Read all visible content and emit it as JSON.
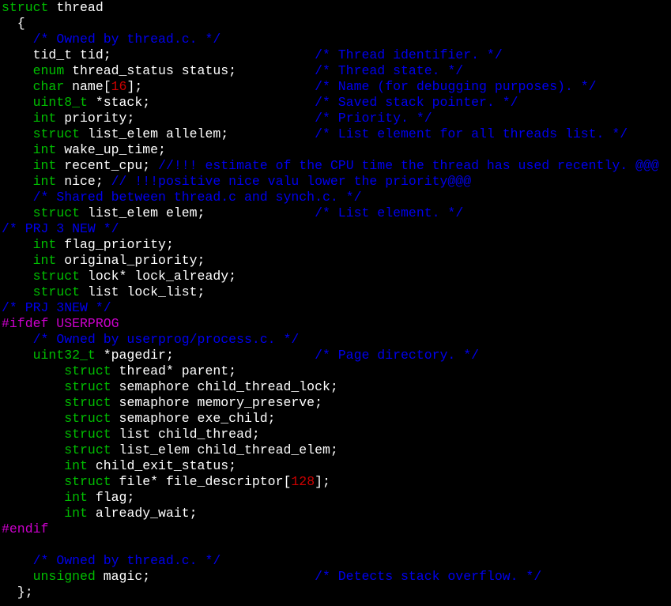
{
  "colors": {
    "background": "#000000",
    "keyword": "#00bd00",
    "identifier": "#ffffff",
    "preprocessor": "#cd00cd",
    "number": "#cd0000",
    "comment": "#0000ee"
  },
  "lines": [
    [
      [
        "kw",
        "struct"
      ],
      [
        "id",
        " thread"
      ]
    ],
    [
      [
        "id",
        "  {"
      ]
    ],
    [
      [
        "id",
        "    "
      ],
      [
        "cm",
        "/* Owned by thread.c. */"
      ]
    ],
    [
      [
        "id",
        "    tid_t tid;                          "
      ],
      [
        "cm",
        "/* Thread identifier. */"
      ]
    ],
    [
      [
        "id",
        "    "
      ],
      [
        "kw",
        "enum"
      ],
      [
        "id",
        " thread_status status;          "
      ],
      [
        "cm",
        "/* Thread state. */"
      ]
    ],
    [
      [
        "id",
        "    "
      ],
      [
        "kw",
        "char"
      ],
      [
        "id",
        " name["
      ],
      [
        "num",
        "16"
      ],
      [
        "id",
        "];                      "
      ],
      [
        "cm",
        "/* Name (for debugging purposes). */"
      ]
    ],
    [
      [
        "id",
        "    "
      ],
      [
        "kw",
        "uint8_t"
      ],
      [
        "id",
        " *stack;                     "
      ],
      [
        "cm",
        "/* Saved stack pointer. */"
      ]
    ],
    [
      [
        "id",
        "    "
      ],
      [
        "kw",
        "int"
      ],
      [
        "id",
        " priority;                       "
      ],
      [
        "cm",
        "/* Priority. */"
      ]
    ],
    [
      [
        "id",
        "    "
      ],
      [
        "kw",
        "struct"
      ],
      [
        "id",
        " list_elem allelem;           "
      ],
      [
        "cm",
        "/* List element for all threads list. */"
      ]
    ],
    [
      [
        "id",
        "    "
      ],
      [
        "kw",
        "int"
      ],
      [
        "id",
        " wake_up_time;"
      ]
    ],
    [
      [
        "id",
        "    "
      ],
      [
        "kw",
        "int"
      ],
      [
        "id",
        " recent_cpu; "
      ],
      [
        "cm",
        "//!!! estimate of the CPU time the thread has used recently. @@@"
      ]
    ],
    [
      [
        "id",
        "    "
      ],
      [
        "kw",
        "int"
      ],
      [
        "id",
        " nice; "
      ],
      [
        "cm",
        "// !!!positive nice valu lower the priority@@@"
      ]
    ],
    [
      [
        "id",
        "    "
      ],
      [
        "cm",
        "/* Shared between thread.c and synch.c. */"
      ]
    ],
    [
      [
        "id",
        "    "
      ],
      [
        "kw",
        "struct"
      ],
      [
        "id",
        " list_elem elem;              "
      ],
      [
        "cm",
        "/* List element. */"
      ]
    ],
    [
      [
        "cm",
        "/* PRJ 3 NEW */"
      ]
    ],
    [
      [
        "id",
        "    "
      ],
      [
        "kw",
        "int"
      ],
      [
        "id",
        " flag_priority;"
      ]
    ],
    [
      [
        "id",
        "    "
      ],
      [
        "kw",
        "int"
      ],
      [
        "id",
        " original_priority;"
      ]
    ],
    [
      [
        "id",
        "    "
      ],
      [
        "kw",
        "struct"
      ],
      [
        "id",
        " lock* lock_already;"
      ]
    ],
    [
      [
        "id",
        "    "
      ],
      [
        "kw",
        "struct"
      ],
      [
        "id",
        " list lock_list;"
      ]
    ],
    [
      [
        "cm",
        "/* PRJ 3NEW */"
      ]
    ],
    [
      [
        "pp",
        "#ifdef USERPROG"
      ]
    ],
    [
      [
        "id",
        "    "
      ],
      [
        "cm",
        "/* Owned by userprog/process.c. */"
      ]
    ],
    [
      [
        "id",
        "    "
      ],
      [
        "kw",
        "uint32_t"
      ],
      [
        "id",
        " *pagedir;                  "
      ],
      [
        "cm",
        "/* Page directory. */"
      ]
    ],
    [
      [
        "id",
        "        "
      ],
      [
        "kw",
        "struct"
      ],
      [
        "id",
        " thread* parent;"
      ]
    ],
    [
      [
        "id",
        "        "
      ],
      [
        "kw",
        "struct"
      ],
      [
        "id",
        " semaphore child_thread_lock;"
      ]
    ],
    [
      [
        "id",
        "        "
      ],
      [
        "kw",
        "struct"
      ],
      [
        "id",
        " semaphore memory_preserve;"
      ]
    ],
    [
      [
        "id",
        "        "
      ],
      [
        "kw",
        "struct"
      ],
      [
        "id",
        " semaphore exe_child;"
      ]
    ],
    [
      [
        "id",
        "        "
      ],
      [
        "kw",
        "struct"
      ],
      [
        "id",
        " list child_thread;"
      ]
    ],
    [
      [
        "id",
        "        "
      ],
      [
        "kw",
        "struct"
      ],
      [
        "id",
        " list_elem child_thread_elem;"
      ]
    ],
    [
      [
        "id",
        "        "
      ],
      [
        "kw",
        "int"
      ],
      [
        "id",
        " child_exit_status;"
      ]
    ],
    [
      [
        "id",
        "        "
      ],
      [
        "kw",
        "struct"
      ],
      [
        "id",
        " file* file_descriptor["
      ],
      [
        "num",
        "128"
      ],
      [
        "id",
        "];"
      ]
    ],
    [
      [
        "id",
        "        "
      ],
      [
        "kw",
        "int"
      ],
      [
        "id",
        " flag;"
      ]
    ],
    [
      [
        "id",
        "        "
      ],
      [
        "kw",
        "int"
      ],
      [
        "id",
        " already_wait;"
      ]
    ],
    [
      [
        "pp",
        "#endif"
      ]
    ],
    [
      [
        "id",
        ""
      ]
    ],
    [
      [
        "id",
        "    "
      ],
      [
        "cm",
        "/* Owned by thread.c. */"
      ]
    ],
    [
      [
        "id",
        "    "
      ],
      [
        "kw",
        "unsigned"
      ],
      [
        "id",
        " magic;                     "
      ],
      [
        "cm",
        "/* Detects stack overflow. */"
      ]
    ],
    [
      [
        "id",
        "  };"
      ]
    ]
  ]
}
